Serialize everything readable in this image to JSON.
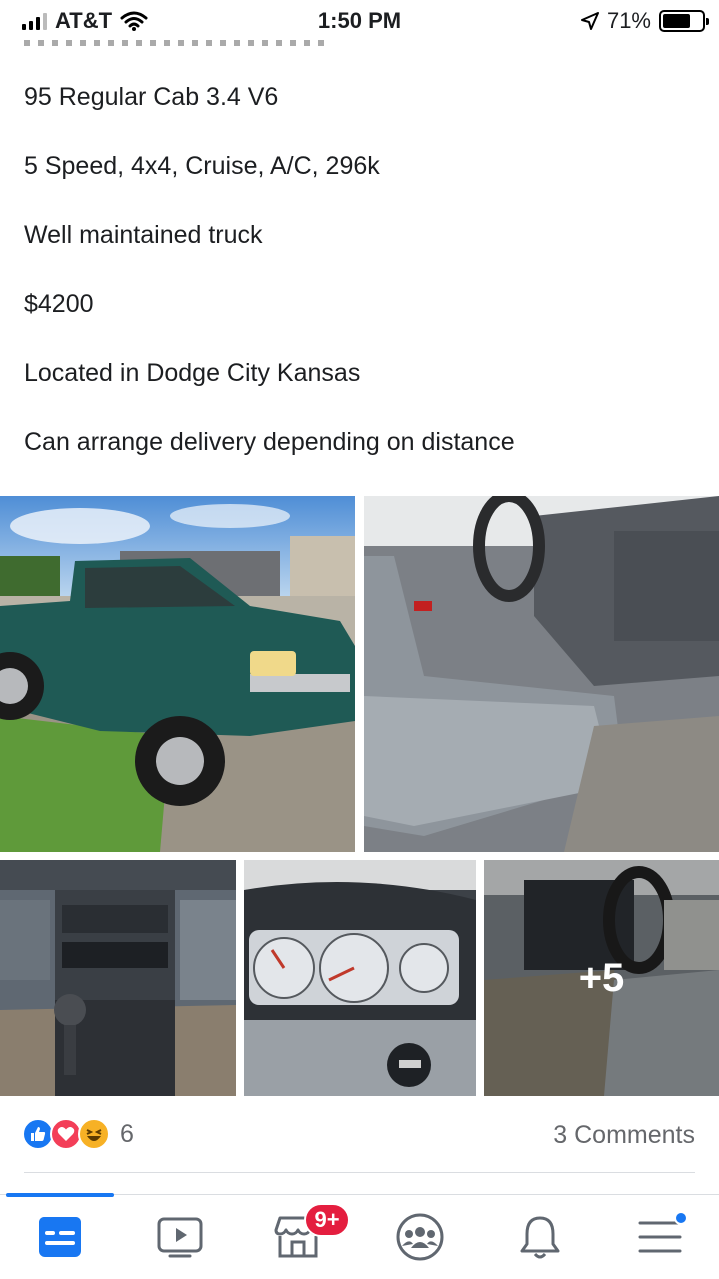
{
  "status_bar": {
    "carrier": "AT&T",
    "time": "1:50 PM",
    "battery": "71%",
    "battery_level": 0.71
  },
  "post": {
    "lines": [
      "95 Regular Cab 3.4 V6",
      "5 Speed, 4x4, Cruise, A/C, 296k",
      "Well maintained truck",
      "$4200",
      "Located in Dodge City Kansas",
      "Can arrange delivery depending on distance"
    ]
  },
  "photos": {
    "items": [
      {
        "subject": "green pickup truck exterior"
      },
      {
        "subject": "truck interior bench seat"
      },
      {
        "subject": "dashboard center console and shifter"
      },
      {
        "subject": "instrument cluster gauges"
      },
      {
        "subject": "driver seat and steering wheel"
      }
    ],
    "more_label": "+5"
  },
  "engagement": {
    "reactions": [
      "like-icon",
      "love-icon",
      "haha-icon"
    ],
    "reaction_count": "6",
    "comments": "3 Comments"
  },
  "tab_bar": {
    "tabs": [
      "news-feed",
      "watch",
      "marketplace",
      "groups",
      "notifications",
      "menu"
    ],
    "marketplace_badge": "9+",
    "active_color": "#1877f2"
  }
}
